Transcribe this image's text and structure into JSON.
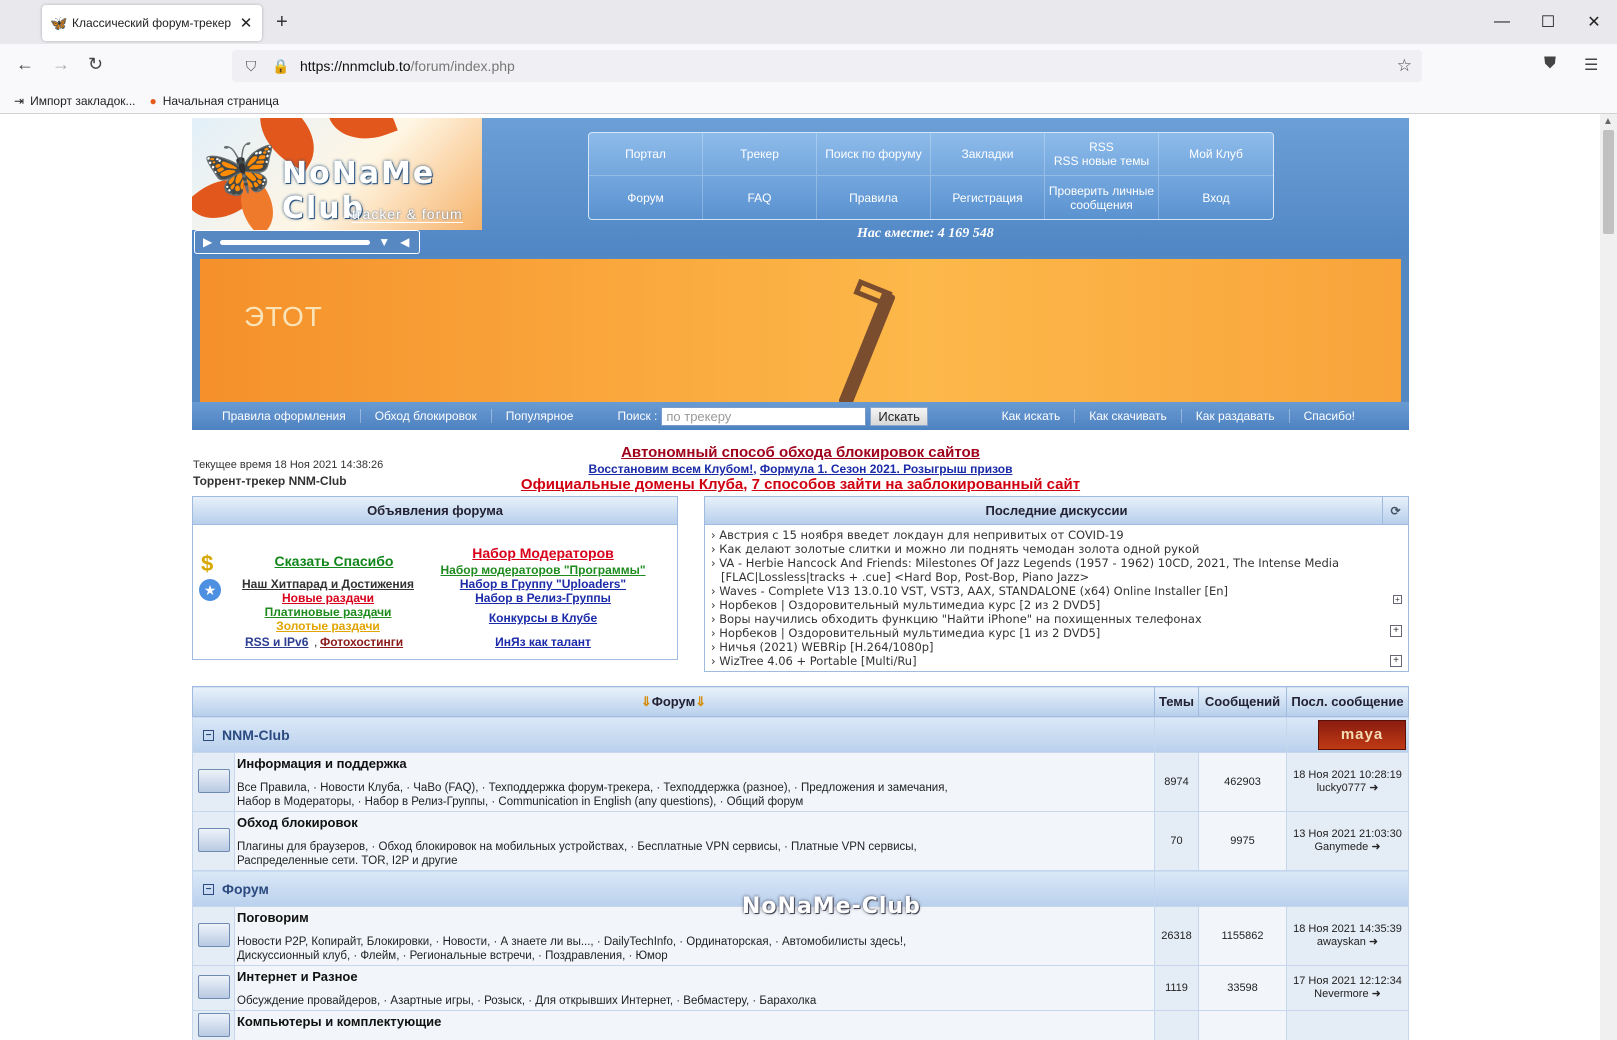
{
  "browser": {
    "tab_title": "Классический форум-трекер",
    "url_host": "https://nnmclub.to",
    "url_path": "/forum/index.php",
    "bookmarks": [
      "Импорт закладок...",
      "Начальная страница"
    ]
  },
  "header": {
    "logo_name": "NoNaMe Club",
    "logo_sub": "tracker & forum",
    "menu": [
      "Портал",
      "Трекер",
      "Поиск по форуму",
      "Закладки",
      "RSS\nRSS новые темы",
      "Мой Клуб",
      "Форум",
      "FAQ",
      "Правила",
      "Регистрация",
      "Проверить личные сообщения",
      "Вход"
    ],
    "together": "Нас вместе: 4 169 548"
  },
  "banner": {
    "text": "ЭТОТ"
  },
  "subnav": {
    "left": [
      "Правила оформления",
      "Обход блокировок",
      "Популярное"
    ],
    "search_label": "Поиск :",
    "search_placeholder": "по трекеру",
    "search_button": "Искать",
    "right": [
      "Как искать",
      "Как скачивать",
      "Как раздавать",
      "Спасибо!"
    ]
  },
  "info": {
    "time": "Текущее время 18 Ноя 2021 14:38:26",
    "tracker_title": "Торрент-трекер NNM-Club",
    "ann1": "Автономный способ обхода блокировок сайтов",
    "ann2a": "Восстановим всем Клубом!",
    "ann2b": "Формула 1. Сезон 2021. Розыгрыш призов",
    "ann3a": "Официальные домены Клуба",
    "ann3b": "7 способов зайти на заблокированный сайт"
  },
  "announcements": {
    "title": "Объявления форума",
    "left": [
      "Сказать Спасибо",
      "Наш Хитпарад и Достижения",
      "Новые раздачи",
      "Платиновые раздачи",
      "Золотые раздачи",
      "RSS и IPv6",
      "Фотохостинги"
    ],
    "right": [
      "Набор Модераторов",
      "Набор модераторов \"Программы\"",
      "Набор в Группу \"Uploaders\"",
      "Набор в Релиз-Группы",
      "Конкурсы в Клубе",
      "ИнЯз как талант"
    ]
  },
  "discussions": {
    "title": "Последние дискуссии",
    "items": [
      "› Австрия с 15 ноября введет локдаун для непривитых от COVID-19",
      "› Как делают золотые слитки и можно ли поднять чемодан золота одной рукой",
      "› VA - Herbie Hancock And Friends: Milestones Of Jazz Legends (1957 - 1962) 10CD, 2021, The Intense Media",
      "[FLAC|Lossless|tracks + .cue] <Hard Bop, Post-Bop, Piano Jazz>",
      "› Waves - Complete V13 13.0.10 VST, VST3, AAX, STANDALONE (x64) Online Installer [En]",
      "› Норбеков | Оздоровительный мультимедиа курс [2 из 2 DVD5]",
      "› Воры научились обходить функцию \"Найти iPhone\" на похищенных телефонах",
      "› Норбеков | Оздоровительный мультимедиа курс [1 из 2 DVD5]",
      "› Ничья (2021) WEBRip [H.264/1080p]",
      "› WizTree 4.06 + Portable [Multi/Ru]"
    ]
  },
  "forum": {
    "headers": [
      "Форум",
      "Темы",
      "Сообщений",
      "Посл. сообщение"
    ],
    "cat1": "NNM-Club",
    "cat2": "Форум",
    "maya": "maya",
    "rows": [
      {
        "title": "Информация и поддержка",
        "subs1": "Все Правила, · Новости Клуба, · ЧаВо (FAQ), · Техподдержка форум-трекера, · Техподдержка (разное), · Предложения и замечания,",
        "subs2": "Набор в Модераторы, · Набор в Релиз-Группы, · Communication in English (any questions), · Общий форум",
        "topics": "8974",
        "posts": "462903",
        "date": "18 Ноя 2021 10:28:19",
        "user": "lucky0777"
      },
      {
        "title": "Обход блокировок",
        "subs1": "Плагины для браузеров, · Обход блокировок на мобильных устройствах, · Бесплатные VPN сервисы, · Платные VPN сервисы,",
        "subs2": "Распределенные сети. TOR, I2P и другие",
        "topics": "70",
        "posts": "9975",
        "date": "13 Ноя 2021 21:03:30",
        "user": "Ganymede"
      },
      {
        "title": "Поговорим",
        "subs1": "Новости P2P, Копирайт, Блокировки, · Новости, · А знаете ли вы..., · DailyTechInfo, · Ординаторская, · Автомобилисты здесь!,",
        "subs2": "Дискуссионный клуб, · Флейм, · Региональные встречи, · Поздравления, · Юмор",
        "topics": "26318",
        "posts": "1155862",
        "date": "18 Ноя 2021 14:35:39",
        "user": "awayskan"
      },
      {
        "title": "Интернет и Разное",
        "subs1": "Обсуждение провайдеров, · Азартные игры, · Розыск, · Для открывших Интернет, · Вебмастеру, · Барахолка",
        "subs2": "",
        "topics": "1119",
        "posts": "33598",
        "date": "17 Ноя 2021 12:12:34",
        "user": "Nevermore"
      },
      {
        "title": "Компьютеры и комплектующие",
        "subs1": "",
        "subs2": "",
        "topics": "",
        "posts": "",
        "date": "",
        "user": ""
      }
    ]
  },
  "watermark": "NoNaMe-Club"
}
